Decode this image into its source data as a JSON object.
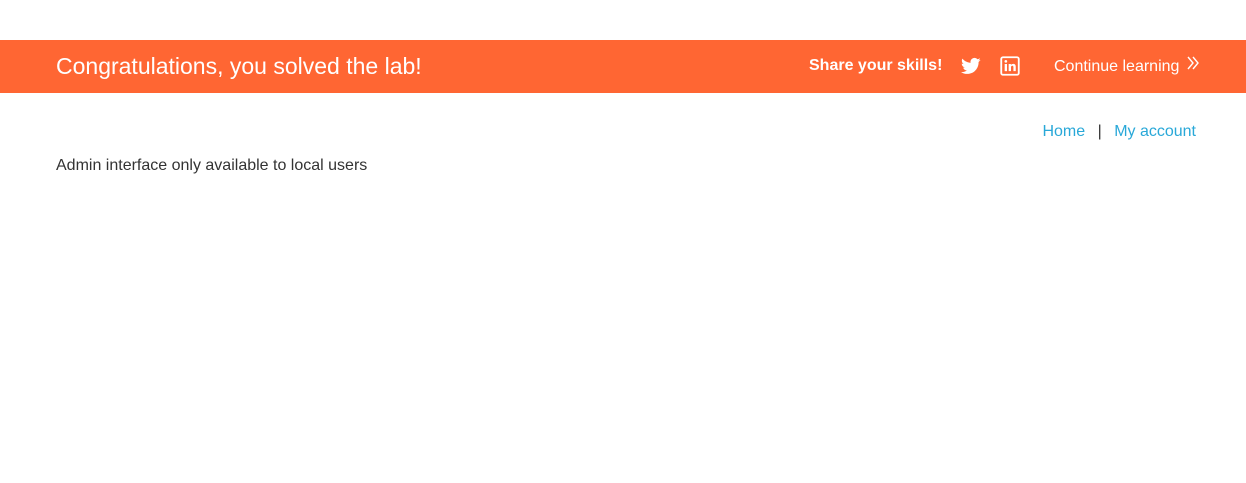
{
  "banner": {
    "title": "Congratulations, you solved the lab!",
    "share_label": "Share your skills!",
    "icons": [
      "twitter-icon",
      "linkedin-icon",
      "chevron-double-right-icon"
    ],
    "continue_label": "Continue learning",
    "background_color": "#ff6633"
  },
  "nav": {
    "home_label": "Home",
    "separator": "|",
    "account_label": "My account",
    "link_color": "#29a8d8"
  },
  "main": {
    "message": "Admin interface only available to local users"
  }
}
